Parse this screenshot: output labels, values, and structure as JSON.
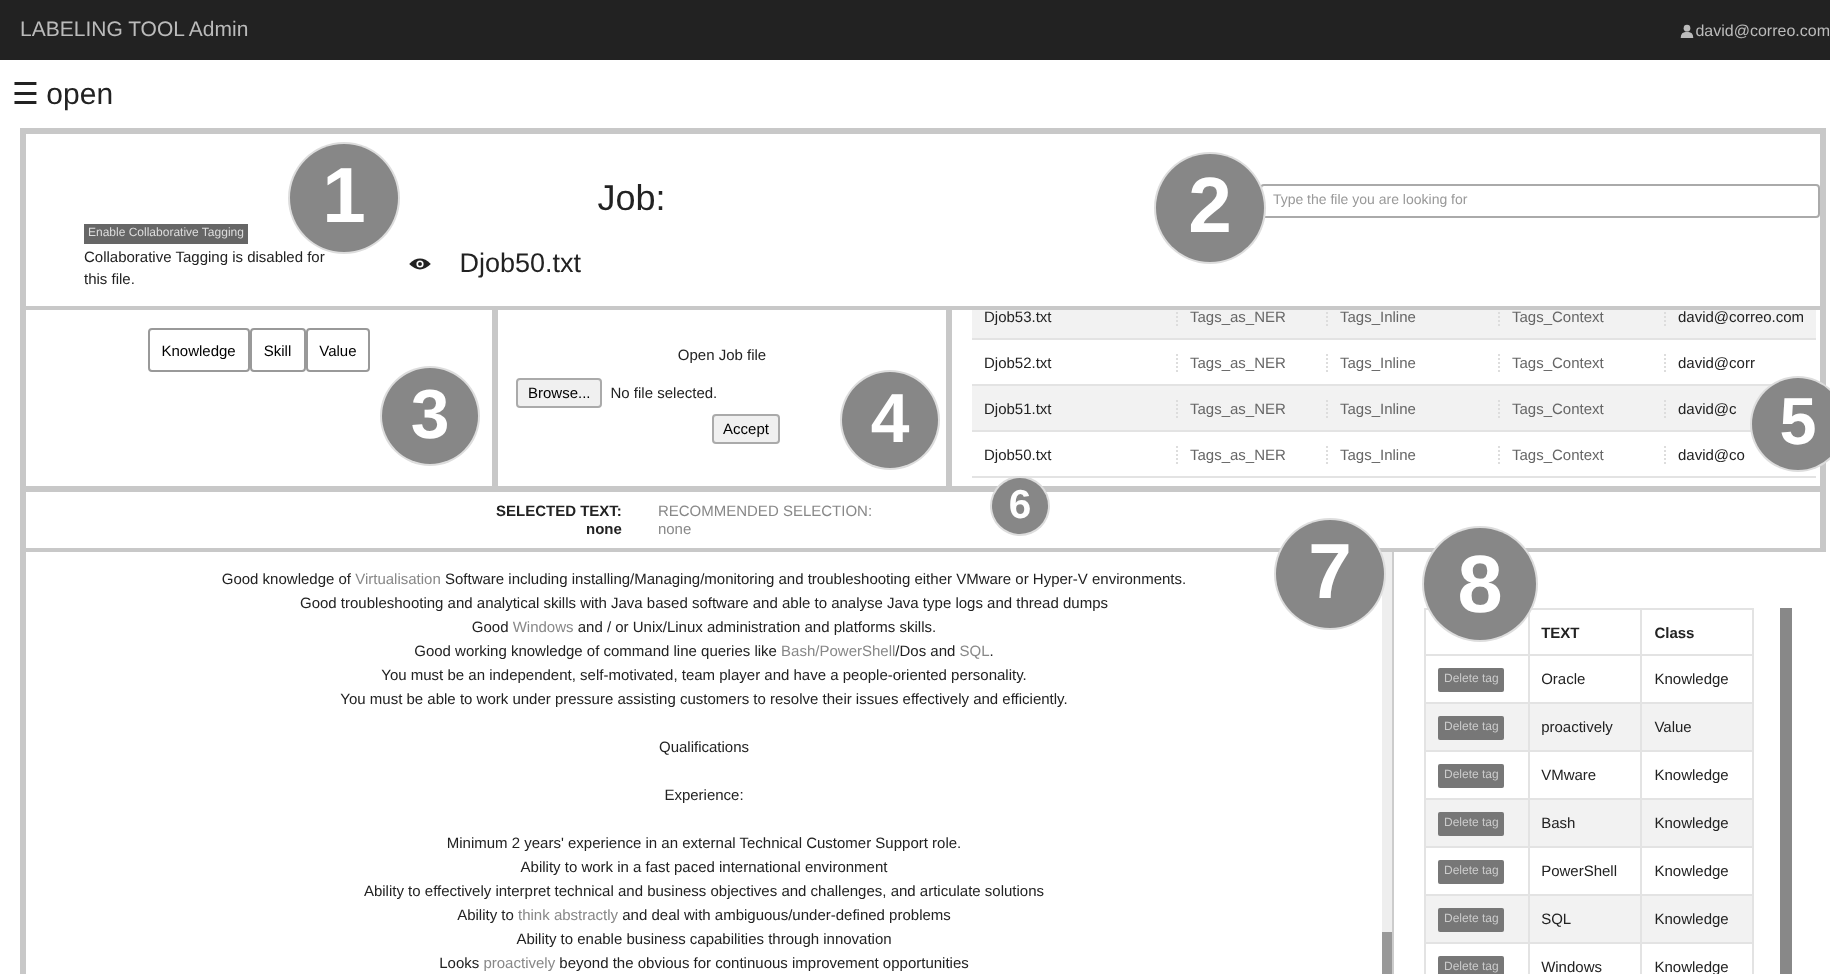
{
  "navbar": {
    "title": "LABELING TOOL Admin",
    "user": "david@correo.com"
  },
  "menu": {
    "icon": "☰",
    "label": "open"
  },
  "job_panel": {
    "collab_button": "Enable Collaborative Tagging",
    "collab_note": "Collaborative Tagging is disabled for this file.",
    "heading": "Job:",
    "file_name": "Djob50.txt",
    "search": {
      "placeholder": "Type the file you are looking for"
    }
  },
  "class_buttons": [
    "Knowledge",
    "Skill",
    "Value"
  ],
  "open_file": {
    "title": "Open Job file",
    "browse": "Browse...",
    "status": "No file selected.",
    "accept": "Accept"
  },
  "files_table": {
    "rows": [
      [
        "Djob53.txt",
        "Tags_as_NER",
        "Tags_Inline",
        "Tags_Context",
        "david@correo.com"
      ],
      [
        "Djob52.txt",
        "Tags_as_NER",
        "Tags_Inline",
        "Tags_Context",
        "david@corr"
      ],
      [
        "Djob51.txt",
        "Tags_as_NER",
        "Tags_Inline",
        "Tags_Context",
        "david@c"
      ],
      [
        "Djob50.txt",
        "Tags_as_NER",
        "Tags_Inline",
        "Tags_Context",
        "david@co"
      ]
    ]
  },
  "selection": {
    "selected_label": "SELECTED TEXT:",
    "selected_value": "none",
    "recommended_label": "RECOMMENDED SELECTION:",
    "recommended_value": "none"
  },
  "document": {
    "paragraphs": [
      {
        "lines": [
          [
            {
              "text": "Good knowledge of ",
              "tagged": false
            },
            {
              "text": "Virtualisation",
              "tagged": true
            },
            {
              "text": " Software including installing/Managing/monitoring and troubleshooting either VMware or Hyper-V environments.",
              "tagged": false
            }
          ],
          [
            {
              "text": "Good troubleshooting and analytical skills with Java based software and able to analyse Java type logs and thread dumps",
              "tagged": false
            }
          ],
          [
            {
              "text": "Good ",
              "tagged": false
            },
            {
              "text": "Windows",
              "tagged": true
            },
            {
              "text": " and / or Unix/Linux administration and platforms skills.",
              "tagged": false
            }
          ],
          [
            {
              "text": "Good working knowledge of command line queries like ",
              "tagged": false
            },
            {
              "text": "Bash/PowerShell",
              "tagged": true
            },
            {
              "text": "/Dos and ",
              "tagged": false
            },
            {
              "text": "SQL",
              "tagged": true
            },
            {
              "text": ".",
              "tagged": false
            }
          ],
          [
            {
              "text": "You must be an independent, self-motivated, team player and have a people-oriented personality.",
              "tagged": false
            }
          ],
          [
            {
              "text": "You must be able to work under pressure assisting customers to resolve their issues effectively and efficiently.",
              "tagged": false
            }
          ]
        ]
      },
      {
        "lines": [
          [
            {
              "text": "Qualifications",
              "tagged": false
            }
          ]
        ]
      },
      {
        "lines": [
          [
            {
              "text": "Experience:",
              "tagged": false
            }
          ]
        ]
      },
      {
        "lines": [
          [
            {
              "text": "Minimum 2 years' experience in an external Technical Customer Support role.",
              "tagged": false
            }
          ],
          [
            {
              "text": "Ability to work in a fast paced international environment",
              "tagged": false
            }
          ],
          [
            {
              "text": "Ability to effectively interpret technical and business objectives and challenges, and articulate solutions",
              "tagged": false
            }
          ],
          [
            {
              "text": "Ability to ",
              "tagged": false
            },
            {
              "text": "think abstractly",
              "tagged": true
            },
            {
              "text": " and deal with ambiguous/under-defined problems",
              "tagged": false
            }
          ],
          [
            {
              "text": "Ability to enable business capabilities through innovation",
              "tagged": false
            }
          ],
          [
            {
              "text": "Looks ",
              "tagged": false
            },
            {
              "text": "proactively",
              "tagged": true
            },
            {
              "text": " beyond the obvious for continuous improvement opportunities",
              "tagged": false
            }
          ]
        ]
      }
    ]
  },
  "tags_table": {
    "columns": [
      "TEXT",
      "Class"
    ],
    "rows": [
      {
        "button": "Delete tag",
        "text": "Oracle",
        "class": "Knowledge"
      },
      {
        "button": "Delete tag",
        "text": "proactively",
        "class": "Value"
      },
      {
        "button": "Delete tag",
        "text": "VMware",
        "class": "Knowledge"
      },
      {
        "button": "Delete tag",
        "text": "Bash",
        "class": "Knowledge"
      },
      {
        "button": "Delete tag",
        "text": "PowerShell",
        "class": "Knowledge"
      },
      {
        "button": "Delete tag",
        "text": "SQL",
        "class": "Knowledge"
      },
      {
        "button": "Delete tag",
        "text": "Windows",
        "class": "Knowledge"
      }
    ]
  },
  "markers": [
    "1",
    "2",
    "3",
    "4",
    "5",
    "6",
    "7",
    "8"
  ]
}
